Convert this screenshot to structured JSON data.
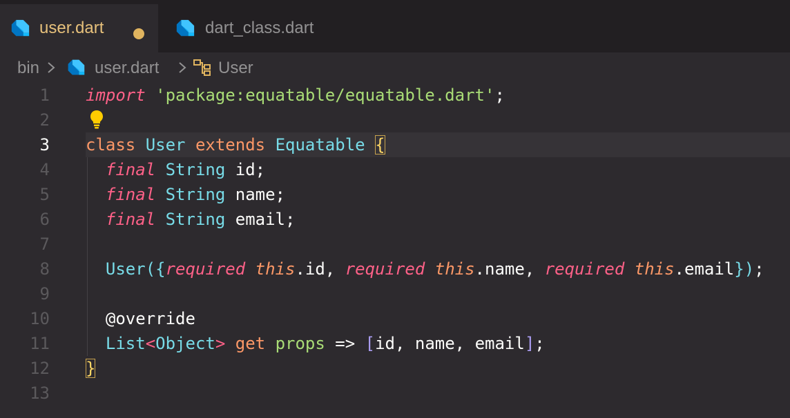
{
  "tabs": [
    {
      "label": "user.dart",
      "active": true,
      "modified": true
    },
    {
      "label": "dart_class.dart",
      "active": false,
      "modified": false
    }
  ],
  "breadcrumb": {
    "folder": "bin",
    "file": "user.dart",
    "symbol": "User"
  },
  "editor": {
    "current_line": 3,
    "lines": [
      {
        "num": "1",
        "tokens": [
          {
            "t": "import",
            "c": "t-kw-it"
          },
          {
            "t": " ",
            "c": ""
          },
          {
            "t": "'package:equatable/equatable.dart'",
            "c": "t-str2"
          },
          {
            "t": ";",
            "c": "t-meta"
          }
        ]
      },
      {
        "num": "2",
        "tokens": []
      },
      {
        "num": "3",
        "tokens": [
          {
            "t": "class",
            "c": "t-kw"
          },
          {
            "t": " ",
            "c": ""
          },
          {
            "t": "User",
            "c": "t-type"
          },
          {
            "t": " ",
            "c": ""
          },
          {
            "t": "extends",
            "c": "t-kw"
          },
          {
            "t": " ",
            "c": ""
          },
          {
            "t": "Equatable",
            "c": "t-type"
          },
          {
            "t": " ",
            "c": ""
          },
          {
            "t": "{",
            "c": "t-brace-y bracket-match"
          }
        ]
      },
      {
        "num": "4",
        "tokens": [
          {
            "t": "  ",
            "c": ""
          },
          {
            "t": "final",
            "c": "t-kw-it"
          },
          {
            "t": " ",
            "c": ""
          },
          {
            "t": "String",
            "c": "t-type"
          },
          {
            "t": " id;",
            "c": "t-meta"
          }
        ]
      },
      {
        "num": "5",
        "tokens": [
          {
            "t": "  ",
            "c": ""
          },
          {
            "t": "final",
            "c": "t-kw-it"
          },
          {
            "t": " ",
            "c": ""
          },
          {
            "t": "String",
            "c": "t-type"
          },
          {
            "t": " name;",
            "c": "t-meta"
          }
        ]
      },
      {
        "num": "6",
        "tokens": [
          {
            "t": "  ",
            "c": ""
          },
          {
            "t": "final",
            "c": "t-kw-it"
          },
          {
            "t": " ",
            "c": ""
          },
          {
            "t": "String",
            "c": "t-type"
          },
          {
            "t": " email;",
            "c": "t-meta"
          }
        ]
      },
      {
        "num": "7",
        "tokens": []
      },
      {
        "num": "8",
        "tokens": [
          {
            "t": "  ",
            "c": ""
          },
          {
            "t": "User",
            "c": "t-type"
          },
          {
            "t": "(",
            "c": "t-brace-b"
          },
          {
            "t": "{",
            "c": "t-brace-b"
          },
          {
            "t": "required",
            "c": "t-kw-it"
          },
          {
            "t": " ",
            "c": ""
          },
          {
            "t": "this",
            "c": "t-kw-it-orange"
          },
          {
            "t": ".id, ",
            "c": "t-meta"
          },
          {
            "t": "required",
            "c": "t-kw-it"
          },
          {
            "t": " ",
            "c": ""
          },
          {
            "t": "this",
            "c": "t-kw-it-orange"
          },
          {
            "t": ".name, ",
            "c": "t-meta"
          },
          {
            "t": "required",
            "c": "t-kw-it"
          },
          {
            "t": " ",
            "c": ""
          },
          {
            "t": "this",
            "c": "t-kw-it-orange"
          },
          {
            "t": ".email",
            "c": "t-meta"
          },
          {
            "t": "}",
            "c": "t-brace-b"
          },
          {
            "t": ")",
            "c": "t-brace-b"
          },
          {
            "t": ";",
            "c": "t-meta"
          }
        ]
      },
      {
        "num": "9",
        "tokens": []
      },
      {
        "num": "10",
        "tokens": [
          {
            "t": "  ",
            "c": ""
          },
          {
            "t": "@override",
            "c": "t-meta"
          }
        ]
      },
      {
        "num": "11",
        "tokens": [
          {
            "t": "  ",
            "c": ""
          },
          {
            "t": "List",
            "c": "t-type"
          },
          {
            "t": "<",
            "c": "t-kw-it"
          },
          {
            "t": "Object",
            "c": "t-type"
          },
          {
            "t": ">",
            "c": "t-kw-it"
          },
          {
            "t": " ",
            "c": ""
          },
          {
            "t": "get",
            "c": "t-kw"
          },
          {
            "t": " ",
            "c": ""
          },
          {
            "t": "props",
            "c": "t-fn"
          },
          {
            "t": " => ",
            "c": "t-meta"
          },
          {
            "t": "[",
            "c": "t-brace-p"
          },
          {
            "t": "id, name, email",
            "c": "t-meta"
          },
          {
            "t": "]",
            "c": "t-brace-p"
          },
          {
            "t": ";",
            "c": "t-meta"
          }
        ]
      },
      {
        "num": "12",
        "tokens": [
          {
            "t": "}",
            "c": "t-brace-y bracket-match"
          }
        ]
      },
      {
        "num": "13",
        "tokens": []
      }
    ]
  }
}
